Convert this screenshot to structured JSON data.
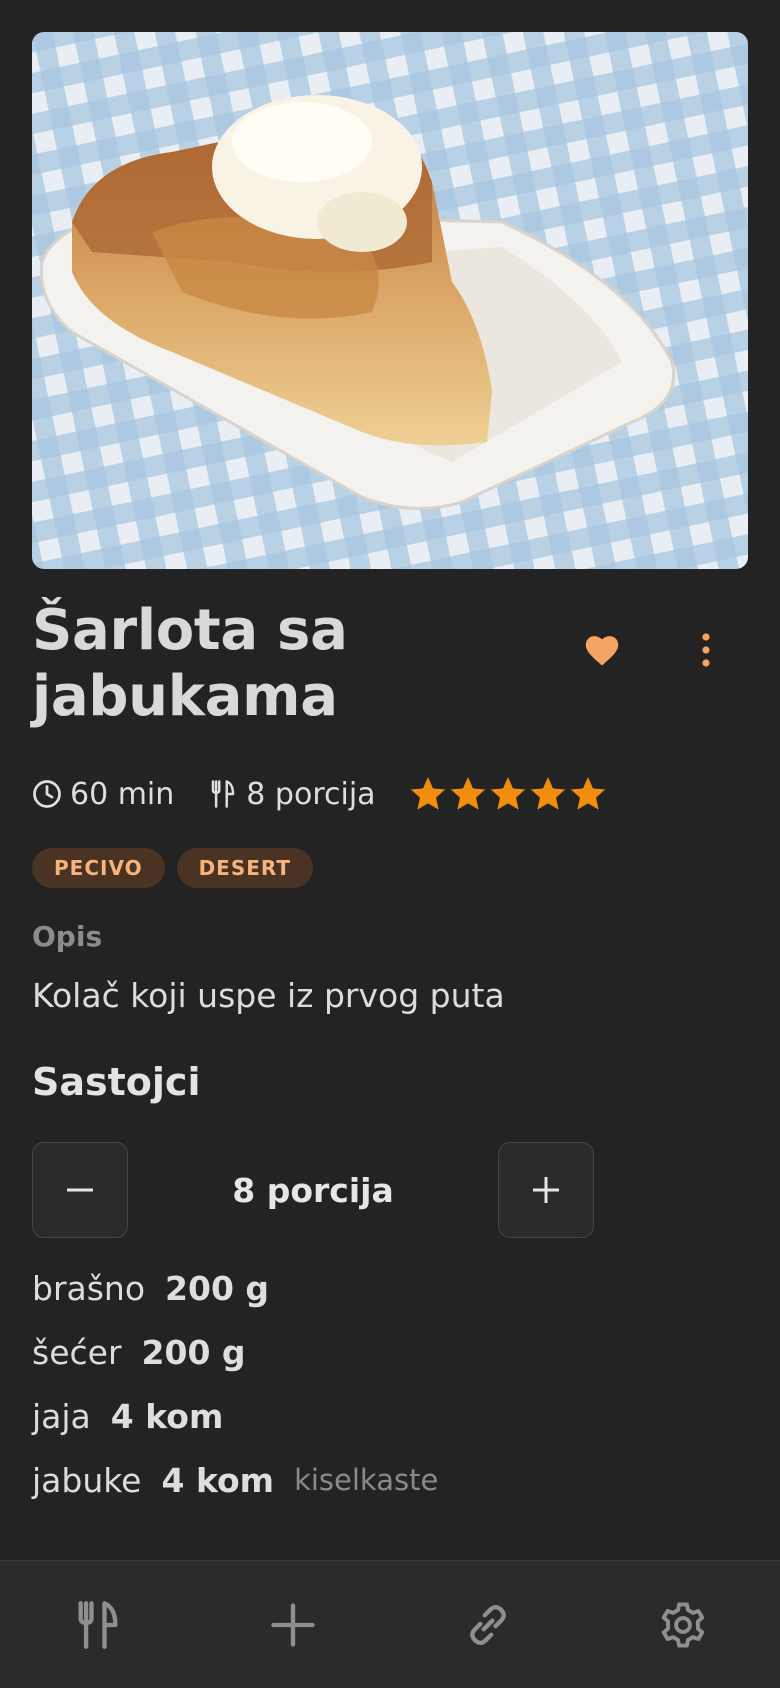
{
  "recipe": {
    "title": "Šarlota sa jabukama",
    "photo_alt": "recipe-photo",
    "time": "60 min",
    "servings": "8 porcija",
    "rating": 5,
    "rating_max": 5,
    "tags": [
      "PECIVO",
      "DESERT"
    ],
    "description_label": "Opis",
    "description": "Kolač koji uspe iz prvog puta"
  },
  "ingredients_section": {
    "title": "Sastojci",
    "servings_value": "8 porcija",
    "items": [
      {
        "name": "brašno",
        "qty": "200 g",
        "note": ""
      },
      {
        "name": "šećer",
        "qty": "200 g",
        "note": ""
      },
      {
        "name": "jaja",
        "qty": "4 kom",
        "note": ""
      },
      {
        "name": "jabuke",
        "qty": "4 kom",
        "note": "kiselkaste"
      }
    ]
  },
  "icons": {
    "favorite": "heart-icon",
    "more": "more-vertical-icon",
    "time": "clock-icon",
    "servings": "utensils-icon",
    "star": "star-icon",
    "minus": "minus-icon",
    "plus": "plus-icon",
    "nav": [
      "utensils-icon",
      "plus-icon",
      "link-icon",
      "gear-icon"
    ]
  },
  "colors": {
    "background": "#232323",
    "accent": "#f5a463",
    "star": "#f28c0f",
    "tag_bg": "#4a3322",
    "tag_text": "#f6b47c"
  }
}
